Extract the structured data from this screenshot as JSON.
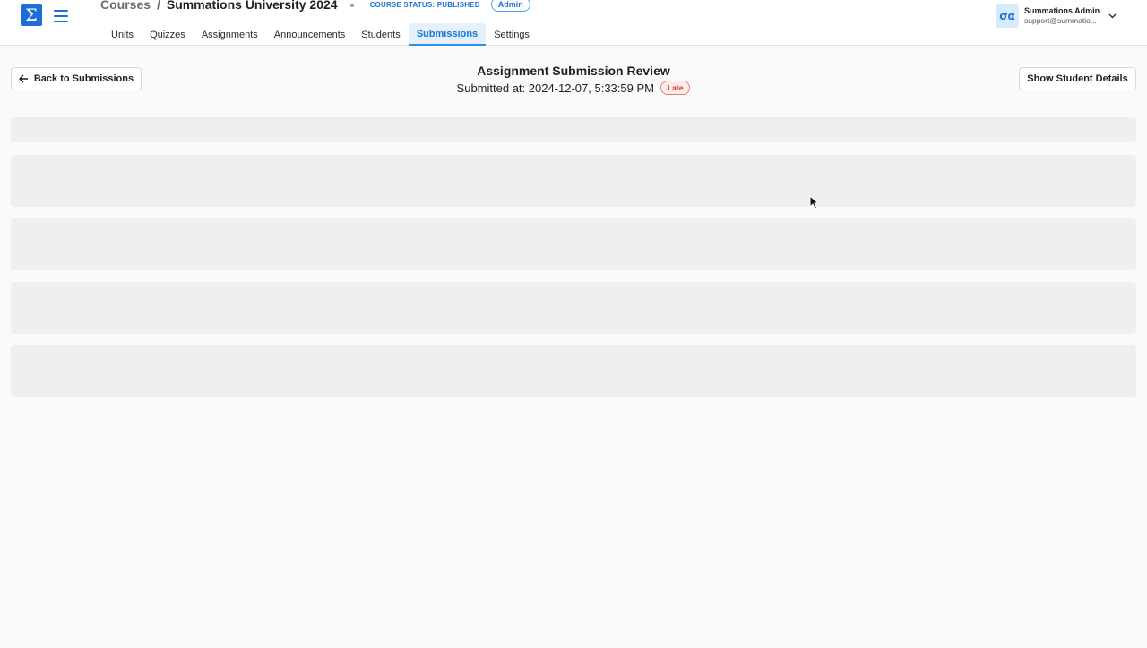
{
  "header": {
    "logo_symbol": "Σ",
    "breadcrumb": {
      "root": "Courses",
      "separator": "/",
      "current": "Summations University 2024"
    },
    "course_status": "COURSE STATUS: PUBLISHED",
    "role_badge": "Admin",
    "tabs": [
      {
        "label": "Units"
      },
      {
        "label": "Quizzes"
      },
      {
        "label": "Assignments"
      },
      {
        "label": "Announcements"
      },
      {
        "label": "Students"
      },
      {
        "label": "Submissions",
        "active": true
      },
      {
        "label": "Settings"
      }
    ],
    "user": {
      "avatar_text": "σα",
      "name": "Summations Admin",
      "email": "support@summatio..."
    }
  },
  "toolbar": {
    "back_label": "Back to Submissions",
    "details_label": "Show Student Details"
  },
  "review": {
    "title": "Assignment Submission Review",
    "submitted_text": "Submitted at: 2024-12-07, 5:33:59 PM",
    "status_badge": "Late"
  },
  "colors": {
    "accent": "#1e73d6",
    "late": "#d0342c",
    "skeleton": "#efefef"
  }
}
